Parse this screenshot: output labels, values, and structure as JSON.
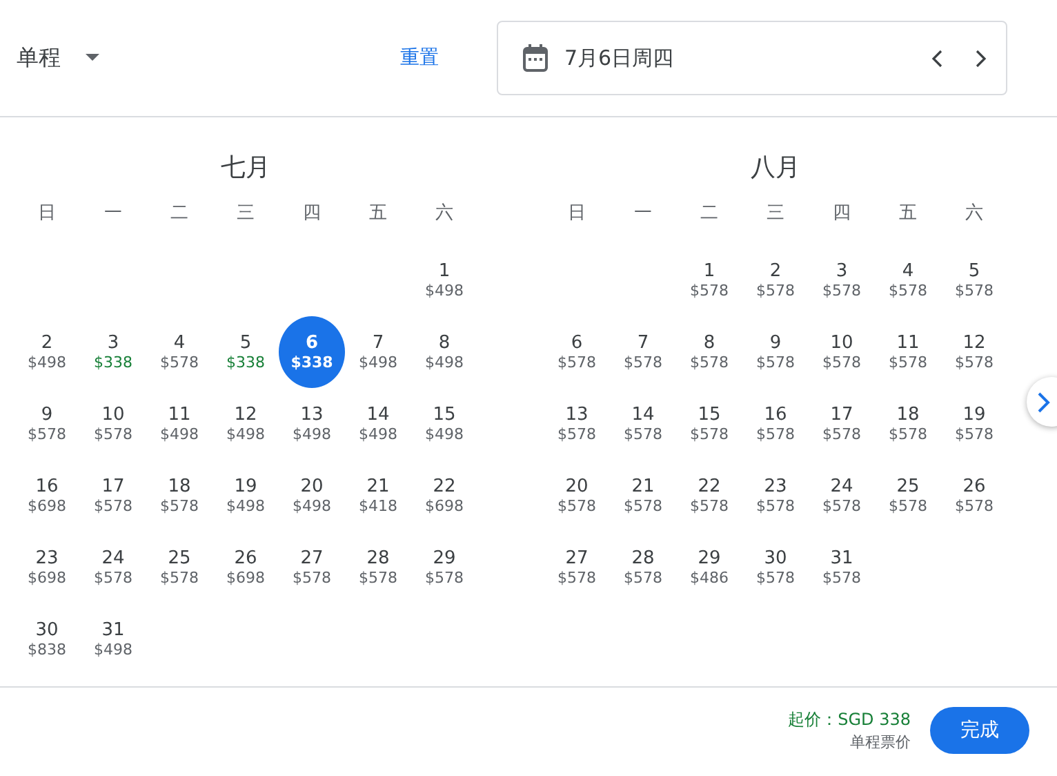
{
  "trip_type": {
    "label": "单程"
  },
  "reset_link": "重置",
  "date_field": {
    "value": "7月6日周四"
  },
  "months": [
    {
      "title": "七月",
      "weekdays": [
        "日",
        "一",
        "二",
        "三",
        "四",
        "五",
        "六"
      ],
      "days": [
        {
          "day": "1",
          "price": "$498",
          "low": false,
          "selected": false
        },
        {
          "day": "2",
          "price": "$498",
          "low": false,
          "selected": false
        },
        {
          "day": "3",
          "price": "$338",
          "low": true,
          "selected": false
        },
        {
          "day": "4",
          "price": "$578",
          "low": false,
          "selected": false
        },
        {
          "day": "5",
          "price": "$338",
          "low": true,
          "selected": false
        },
        {
          "day": "6",
          "price": "$338",
          "low": true,
          "selected": true
        },
        {
          "day": "7",
          "price": "$498",
          "low": false,
          "selected": false
        },
        {
          "day": "8",
          "price": "$498",
          "low": false,
          "selected": false
        },
        {
          "day": "9",
          "price": "$578",
          "low": false,
          "selected": false
        },
        {
          "day": "10",
          "price": "$578",
          "low": false,
          "selected": false
        },
        {
          "day": "11",
          "price": "$498",
          "low": false,
          "selected": false
        },
        {
          "day": "12",
          "price": "$498",
          "low": false,
          "selected": false
        },
        {
          "day": "13",
          "price": "$498",
          "low": false,
          "selected": false
        },
        {
          "day": "14",
          "price": "$498",
          "low": false,
          "selected": false
        },
        {
          "day": "15",
          "price": "$498",
          "low": false,
          "selected": false
        },
        {
          "day": "16",
          "price": "$698",
          "low": false,
          "selected": false
        },
        {
          "day": "17",
          "price": "$578",
          "low": false,
          "selected": false
        },
        {
          "day": "18",
          "price": "$578",
          "low": false,
          "selected": false
        },
        {
          "day": "19",
          "price": "$498",
          "low": false,
          "selected": false
        },
        {
          "day": "20",
          "price": "$498",
          "low": false,
          "selected": false
        },
        {
          "day": "21",
          "price": "$418",
          "low": false,
          "selected": false
        },
        {
          "day": "22",
          "price": "$698",
          "low": false,
          "selected": false
        },
        {
          "day": "23",
          "price": "$698",
          "low": false,
          "selected": false
        },
        {
          "day": "24",
          "price": "$578",
          "low": false,
          "selected": false
        },
        {
          "day": "25",
          "price": "$578",
          "low": false,
          "selected": false
        },
        {
          "day": "26",
          "price": "$698",
          "low": false,
          "selected": false
        },
        {
          "day": "27",
          "price": "$578",
          "low": false,
          "selected": false
        },
        {
          "day": "28",
          "price": "$578",
          "low": false,
          "selected": false
        },
        {
          "day": "29",
          "price": "$578",
          "low": false,
          "selected": false
        },
        {
          "day": "30",
          "price": "$838",
          "low": false,
          "selected": false
        },
        {
          "day": "31",
          "price": "$498",
          "low": false,
          "selected": false
        }
      ]
    },
    {
      "title": "八月",
      "weekdays": [
        "日",
        "一",
        "二",
        "三",
        "四",
        "五",
        "六"
      ],
      "days": [
        {
          "day": "1",
          "price": "$578",
          "low": false,
          "selected": false
        },
        {
          "day": "2",
          "price": "$578",
          "low": false,
          "selected": false
        },
        {
          "day": "3",
          "price": "$578",
          "low": false,
          "selected": false
        },
        {
          "day": "4",
          "price": "$578",
          "low": false,
          "selected": false
        },
        {
          "day": "5",
          "price": "$578",
          "low": false,
          "selected": false
        },
        {
          "day": "6",
          "price": "$578",
          "low": false,
          "selected": false
        },
        {
          "day": "7",
          "price": "$578",
          "low": false,
          "selected": false
        },
        {
          "day": "8",
          "price": "$578",
          "low": false,
          "selected": false
        },
        {
          "day": "9",
          "price": "$578",
          "low": false,
          "selected": false
        },
        {
          "day": "10",
          "price": "$578",
          "low": false,
          "selected": false
        },
        {
          "day": "11",
          "price": "$578",
          "low": false,
          "selected": false
        },
        {
          "day": "12",
          "price": "$578",
          "low": false,
          "selected": false
        },
        {
          "day": "13",
          "price": "$578",
          "low": false,
          "selected": false
        },
        {
          "day": "14",
          "price": "$578",
          "low": false,
          "selected": false
        },
        {
          "day": "15",
          "price": "$578",
          "low": false,
          "selected": false
        },
        {
          "day": "16",
          "price": "$578",
          "low": false,
          "selected": false
        },
        {
          "day": "17",
          "price": "$578",
          "low": false,
          "selected": false
        },
        {
          "day": "18",
          "price": "$578",
          "low": false,
          "selected": false
        },
        {
          "day": "19",
          "price": "$578",
          "low": false,
          "selected": false
        },
        {
          "day": "20",
          "price": "$578",
          "low": false,
          "selected": false
        },
        {
          "day": "21",
          "price": "$578",
          "low": false,
          "selected": false
        },
        {
          "day": "22",
          "price": "$578",
          "low": false,
          "selected": false
        },
        {
          "day": "23",
          "price": "$578",
          "low": false,
          "selected": false
        },
        {
          "day": "24",
          "price": "$578",
          "low": false,
          "selected": false
        },
        {
          "day": "25",
          "price": "$578",
          "low": false,
          "selected": false
        },
        {
          "day": "26",
          "price": "$578",
          "low": false,
          "selected": false
        },
        {
          "day": "27",
          "price": "$578",
          "low": false,
          "selected": false
        },
        {
          "day": "28",
          "price": "$578",
          "low": false,
          "selected": false
        },
        {
          "day": "29",
          "price": "$486",
          "low": false,
          "selected": false
        },
        {
          "day": "30",
          "price": "$578",
          "low": false,
          "selected": false
        },
        {
          "day": "31",
          "price": "$578",
          "low": false,
          "selected": false
        }
      ]
    }
  ],
  "footer": {
    "from_price": "起价：SGD 338",
    "price_note": "单程票价",
    "done_button": "完成"
  }
}
